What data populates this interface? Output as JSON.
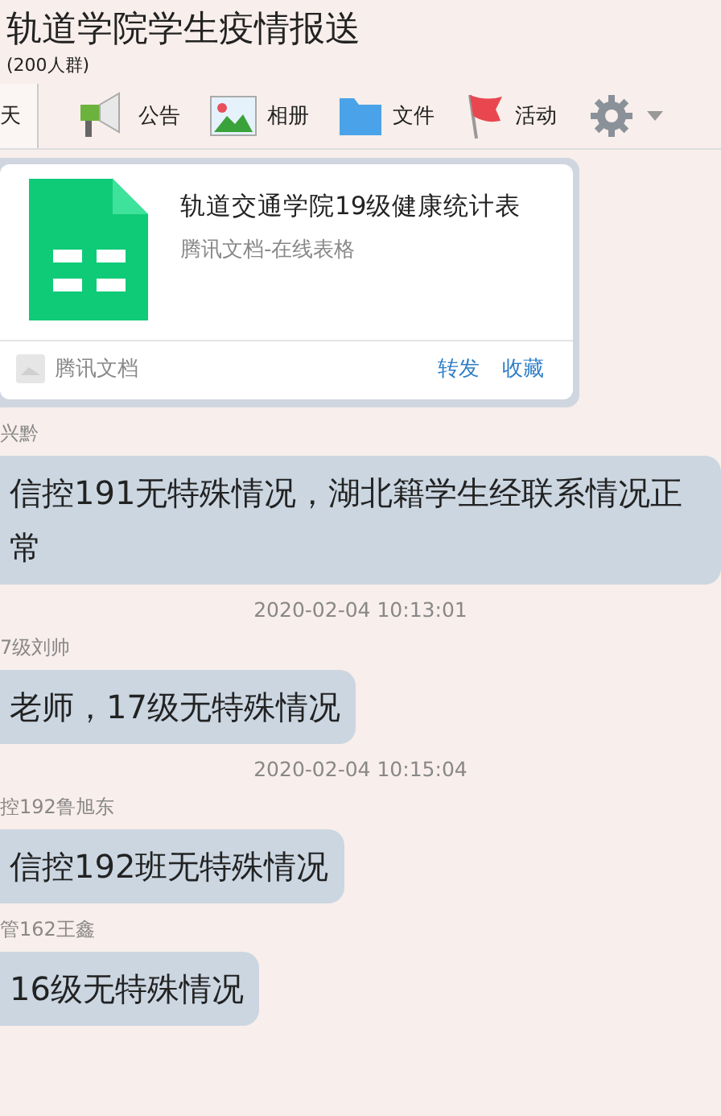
{
  "header": {
    "title": "轨道学院学生疫情报送",
    "member_count": "(200人群)"
  },
  "tabs": [
    {
      "kind": "chat",
      "label": "天",
      "selected": true
    },
    {
      "kind": "notice",
      "label": "公告",
      "selected": false
    },
    {
      "kind": "album",
      "label": "相册",
      "selected": false
    },
    {
      "kind": "file",
      "label": "文件",
      "selected": false
    },
    {
      "kind": "event",
      "label": "活动",
      "selected": false
    }
  ],
  "doc_card": {
    "title": "轨道交通学院19级健康统计表",
    "subtitle": "腾讯文档-在线表格",
    "source": "腾讯文档",
    "actions": [
      "转发",
      "收藏"
    ]
  },
  "feed": [
    {
      "kind": "message",
      "sender": "兴黔",
      "text": "信控191无特殊情况，湖北籍学生经联系情况正常"
    },
    {
      "kind": "time",
      "text": "2020-02-04 10:13:01"
    },
    {
      "kind": "message",
      "sender": "7级刘帅",
      "text": "老师，17级无特殊情况"
    },
    {
      "kind": "time",
      "text": "2020-02-04 10:15:04"
    },
    {
      "kind": "message",
      "sender": "控192鲁旭东",
      "text": "信控192班无特殊情况"
    },
    {
      "kind": "message",
      "sender": "管162王鑫",
      "text": "16级无特殊情况"
    }
  ]
}
